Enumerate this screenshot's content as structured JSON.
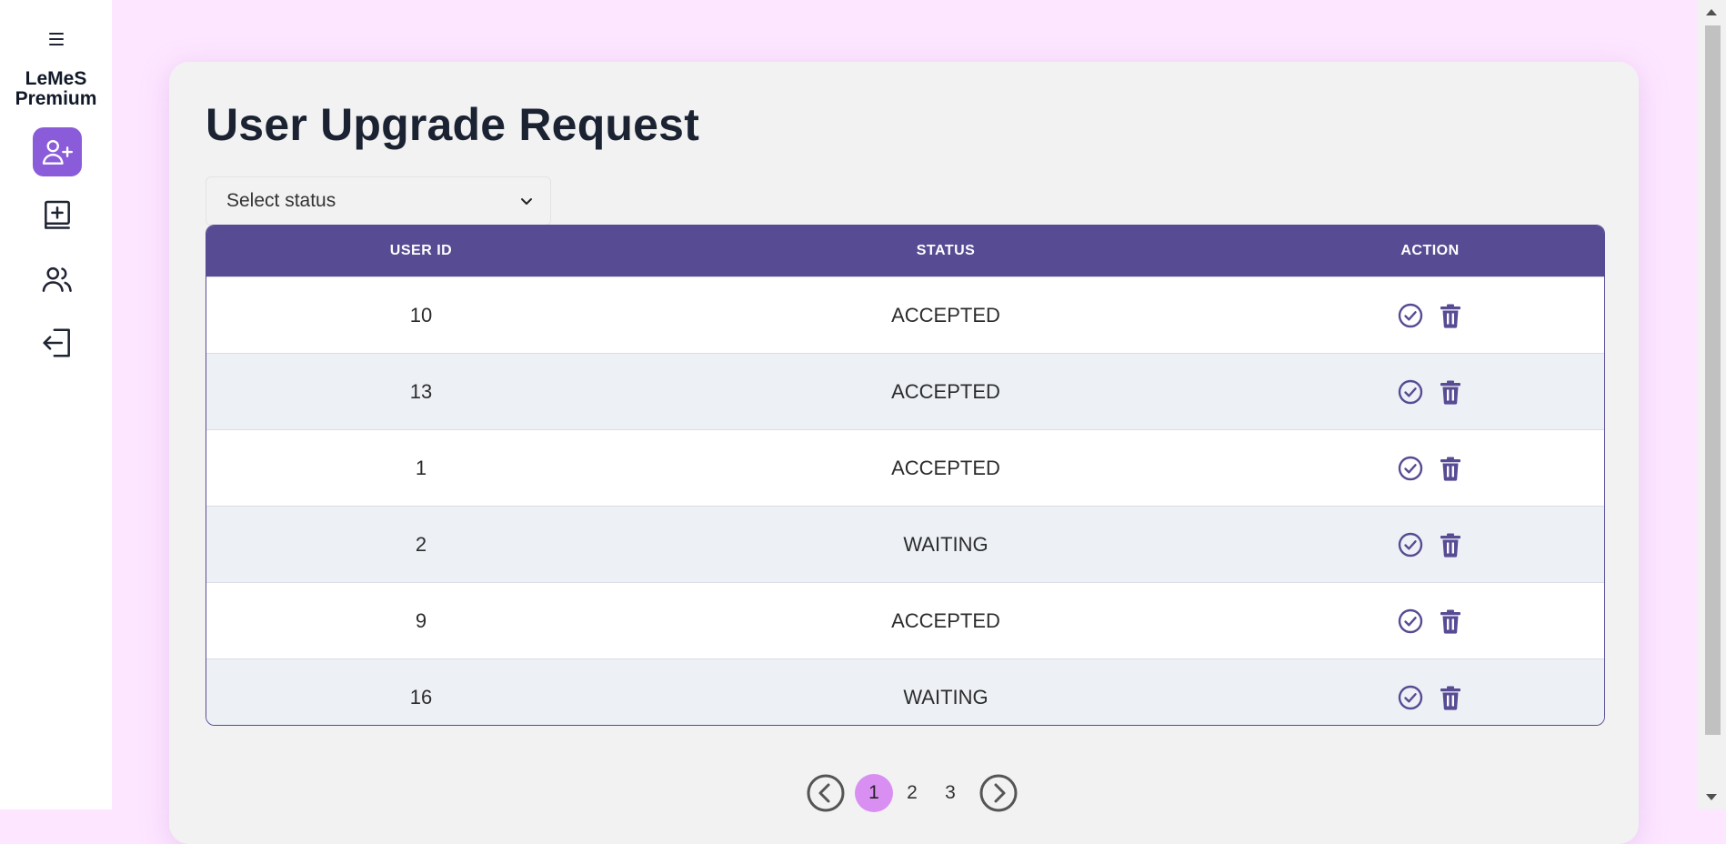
{
  "brand": {
    "line1": "LeMeS",
    "line2": "Premium"
  },
  "sidebar": {
    "items": [
      {
        "name": "upgrade-requests",
        "icon": "user-plus-icon",
        "active": true
      },
      {
        "name": "add-book",
        "icon": "book-plus-icon",
        "active": false
      },
      {
        "name": "users",
        "icon": "users-icon",
        "active": false
      },
      {
        "name": "logout",
        "icon": "logout-icon",
        "active": false
      }
    ]
  },
  "main": {
    "title": "User Upgrade Request",
    "filter": {
      "selected": "Select status"
    },
    "table": {
      "headers": {
        "user_id": "USER ID",
        "status": "STATUS",
        "action": "ACTION"
      },
      "rows": [
        {
          "user_id": "10",
          "status": "ACCEPTED"
        },
        {
          "user_id": "13",
          "status": "ACCEPTED"
        },
        {
          "user_id": "1",
          "status": "ACCEPTED"
        },
        {
          "user_id": "2",
          "status": "WAITING"
        },
        {
          "user_id": "9",
          "status": "ACCEPTED"
        },
        {
          "user_id": "16",
          "status": "WAITING"
        }
      ]
    },
    "pagination": {
      "pages": [
        "1",
        "2",
        "3"
      ],
      "current": "1"
    }
  },
  "colors": {
    "accent": "#574c93",
    "sidebar_active": "#8a5cd9",
    "page_bg": "#fde6ff",
    "current_page": "#d98ff2"
  }
}
